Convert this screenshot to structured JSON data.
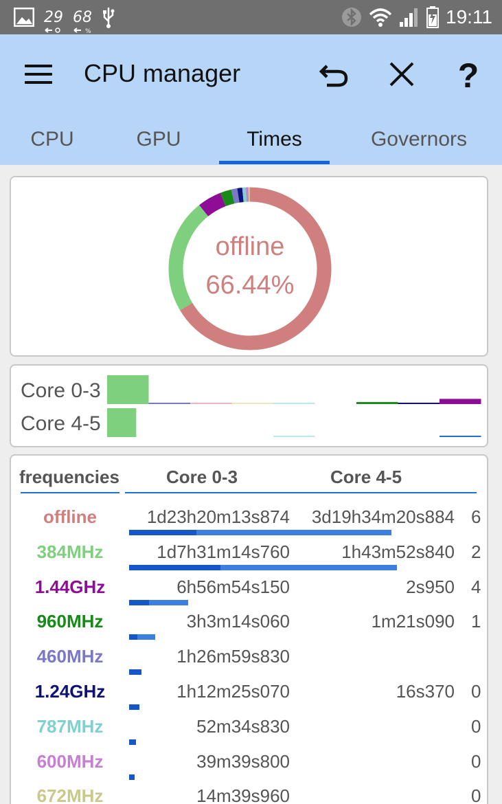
{
  "status_bar": {
    "temp_text": "29",
    "battery_text": "68",
    "time": "19:11",
    "icons": [
      "gallery-icon",
      "temperature-icon",
      "battery-percent-icon",
      "usb-icon",
      "bluetooth-icon",
      "wifi-icon",
      "signal-icon",
      "battery-charging-icon"
    ]
  },
  "toolbar": {
    "title": "CPU manager",
    "icons": [
      "menu-icon",
      "undo-icon",
      "close-icon",
      "help-icon"
    ]
  },
  "tabs": [
    {
      "label": "CPU",
      "active": false
    },
    {
      "label": "GPU",
      "active": false
    },
    {
      "label": "Times",
      "active": true
    },
    {
      "label": "Governors",
      "active": false
    }
  ],
  "donut": {
    "label": "offline",
    "percent": "66.44%",
    "segments": [
      {
        "name": "offline",
        "fraction": 0.6644,
        "color": "#cf7f7d"
      },
      {
        "name": "384MHz",
        "fraction": 0.228,
        "color": "#7ecf7e"
      },
      {
        "name": "1.44GHz",
        "fraction": 0.048,
        "color": "#8e0d96"
      },
      {
        "name": "960MHz",
        "fraction": 0.022,
        "color": "#178a17"
      },
      {
        "name": "460MHz",
        "fraction": 0.012,
        "color": "#7b78c8"
      },
      {
        "name": "1.24GHz",
        "fraction": 0.01,
        "color": "#0d127a"
      },
      {
        "name": "787MHz",
        "fraction": 0.007,
        "color": "#7fd1d1"
      },
      {
        "name": "600MHz",
        "fraction": 0.005,
        "color": "#c77fd1"
      },
      {
        "name": "672MHz",
        "fraction": 0.0036,
        "color": "#c9c98a"
      }
    ]
  },
  "core_bars": {
    "cores": [
      {
        "label": "Core 0-3",
        "levels": [
          {
            "color": "#7ecf7e",
            "value": 1.0
          },
          {
            "color": "#7b78c8",
            "value": 0.03
          },
          {
            "color": "#e8b8c8",
            "value": 0.03
          },
          {
            "color": "#e8e8c0",
            "value": 0.02
          },
          {
            "color": "#b8e8e8",
            "value": 0.02
          },
          {
            "color": "#ffffff",
            "value": 0.0
          },
          {
            "color": "#178a17",
            "value": 0.07
          },
          {
            "color": "#0d127a",
            "value": 0.03
          },
          {
            "color": "#8e0d96",
            "value": 0.18
          }
        ]
      },
      {
        "label": "Core 4-5",
        "levels": [
          {
            "color": "#7ecf7e",
            "value": 1.0
          },
          {
            "color": "#ffffff",
            "value": 0.0
          },
          {
            "color": "#ffffff",
            "value": 0.0
          },
          {
            "color": "#ffffff",
            "value": 0.0
          },
          {
            "color": "#b8e8e8",
            "value": 0.03
          },
          {
            "color": "#ffffff",
            "value": 0.0
          },
          {
            "color": "#ffffff",
            "value": 0.0
          },
          {
            "color": "#ffffff",
            "value": 0.0
          },
          {
            "color": "#1e6fd9",
            "value": 0.03
          }
        ]
      }
    ]
  },
  "table": {
    "headers": {
      "freq": "frequencies",
      "core0": "Core 0-3",
      "core1": "Core 4-5"
    },
    "rows": [
      {
        "freq": "offline",
        "color": "#cf7f7d",
        "core0": "1d23h20m13s874",
        "core1": "3d19h34m20s884",
        "core2": "6",
        "bar0": 0.25,
        "bar1": 0.98
      },
      {
        "freq": "384MHz",
        "color": "#7ecf7e",
        "core0": "1d7h31m14s760",
        "core1": "1h43m52s840",
        "core2": "2",
        "bar0": 0.34,
        "bar1": 1.0
      },
      {
        "freq": "1.44GHz",
        "color": "#8e0d96",
        "core0": "6h56m54s150",
        "core1": "2s950",
        "core2": "4",
        "bar0": 0.075,
        "bar1": 0.22
      },
      {
        "freq": "960MHz",
        "color": "#178a17",
        "core0": "3h3m14s060",
        "core1": "1m21s090",
        "core2": "1",
        "bar0": 0.03,
        "bar1": 0.098
      },
      {
        "freq": "460MHz",
        "color": "#7b78c8",
        "core0": "1h26m59s830",
        "core1": "",
        "core2": "",
        "bar0": 0.045,
        "bar1": 0.0
      },
      {
        "freq": "1.24GHz",
        "color": "#0d127a",
        "core0": "1h12m25s070",
        "core1": "16s370",
        "core2": "0",
        "bar0": 0.038,
        "bar1": 0.0
      },
      {
        "freq": "787MHz",
        "color": "#7fd1d1",
        "core0": "52m34s830",
        "core1": "",
        "core2": "0",
        "bar0": 0.025,
        "bar1": 0.0
      },
      {
        "freq": "600MHz",
        "color": "#c77fd1",
        "core0": "39m39s800",
        "core1": "",
        "core2": "0",
        "bar0": 0.02,
        "bar1": 0.0
      },
      {
        "freq": "672MHz",
        "color": "#c9c98a",
        "core0": "14m39s960",
        "core1": "",
        "core2": "0",
        "bar0": 0.01,
        "bar1": 0.0
      }
    ]
  },
  "colors": {
    "accent": "#1e6fd9",
    "toolbar_bg": "#b7d6f7",
    "status_bar_bg": "#6f6f6f"
  }
}
